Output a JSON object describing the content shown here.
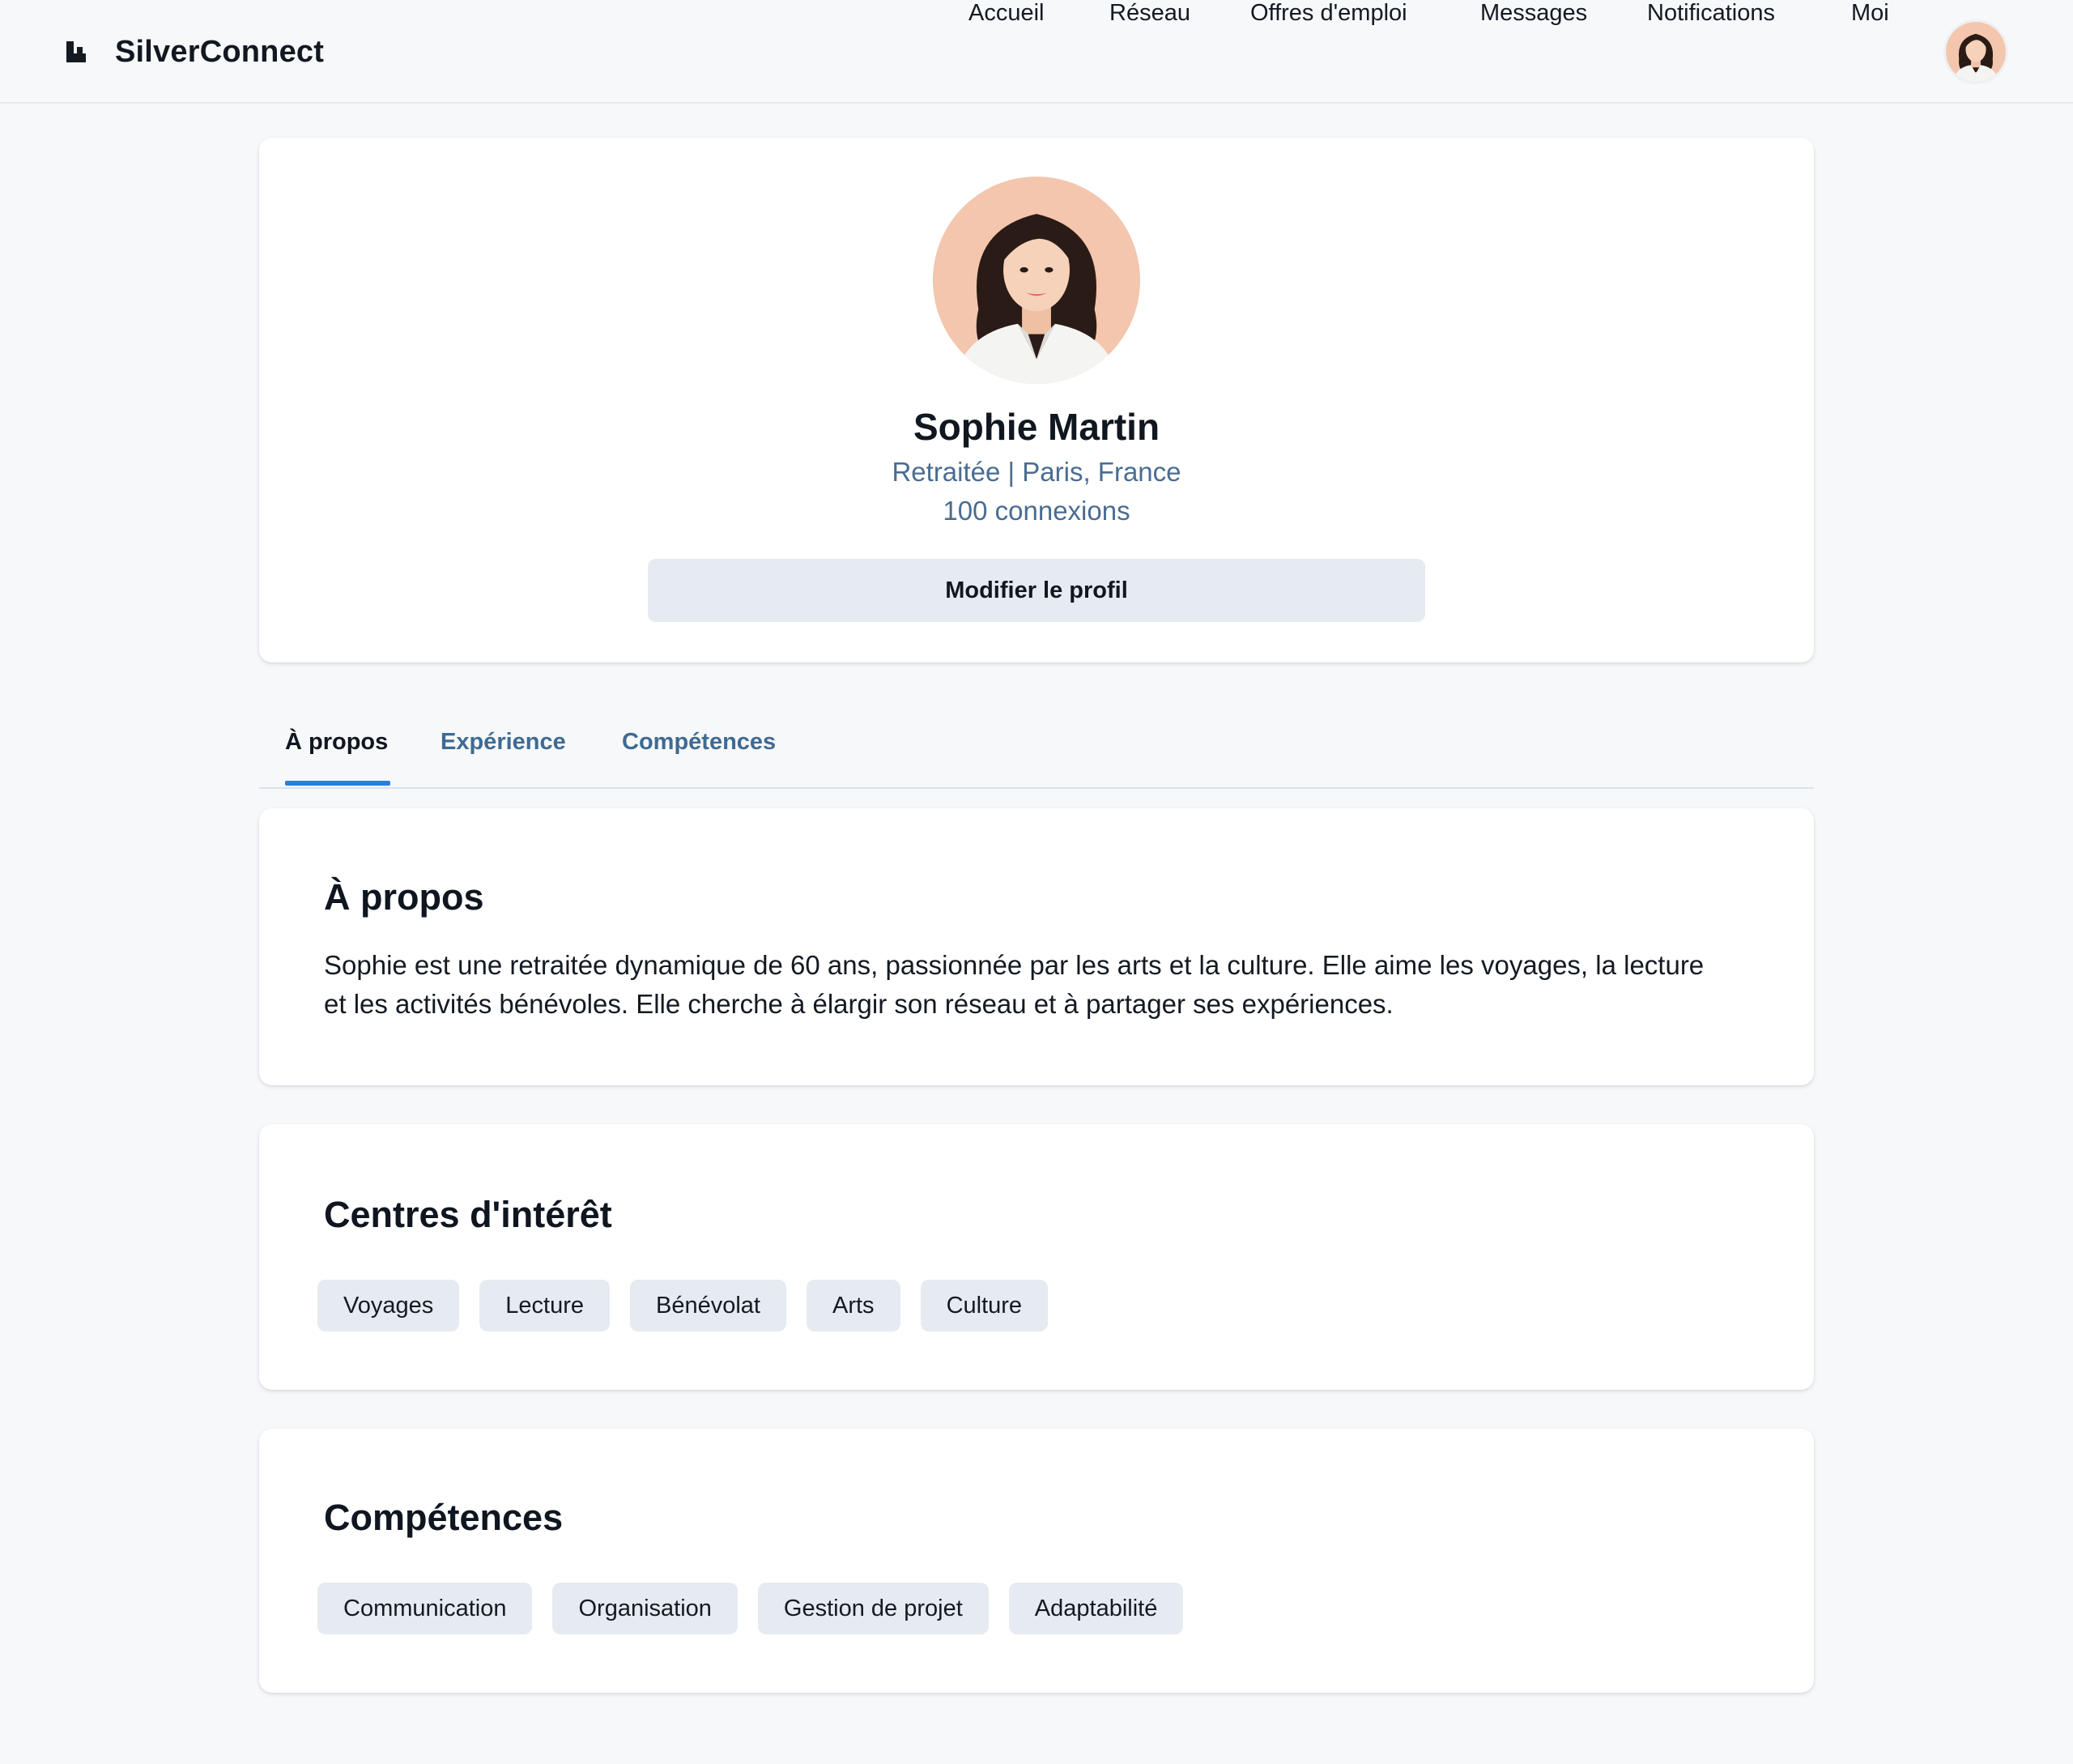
{
  "app": {
    "brand": "SilverConnect"
  },
  "nav": {
    "items": [
      {
        "label": "Accueil"
      },
      {
        "label": "Réseau"
      },
      {
        "label": "Offres d'emploi"
      },
      {
        "label": "Messages"
      },
      {
        "label": "Notifications"
      },
      {
        "label": "Moi"
      }
    ]
  },
  "profile": {
    "name": "Sophie Martin",
    "headline": "Retraitée | Paris, France",
    "connections": "100 connexions",
    "edit_label": "Modifier le profil"
  },
  "tabs": [
    {
      "label": "À propos",
      "active": true
    },
    {
      "label": "Expérience",
      "active": false
    },
    {
      "label": "Compétences",
      "active": false
    }
  ],
  "about": {
    "title": "À propos",
    "text": "Sophie est une retraitée dynamique de 60 ans, passionnée par les arts et la culture. Elle aime les voyages, la lecture et les activités bénévoles. Elle cherche à élargir son réseau et à partager ses expériences."
  },
  "interests": {
    "title": "Centres d'intérêt",
    "items": [
      "Voyages",
      "Lecture",
      "Bénévolat",
      "Arts",
      "Culture"
    ]
  },
  "skills": {
    "title": "Compétences",
    "items": [
      "Communication",
      "Organisation",
      "Gestion de projet",
      "Adaptabilité"
    ]
  },
  "colors": {
    "accent": "#2a7fd8",
    "link": "#3f6a92",
    "subtext": "#4a6c91",
    "chip_bg": "#e6ebf2",
    "page_bg": "#f7f8fa"
  },
  "icons": {
    "logo": "silverconnect-logo-icon",
    "avatar": "user-avatar"
  }
}
